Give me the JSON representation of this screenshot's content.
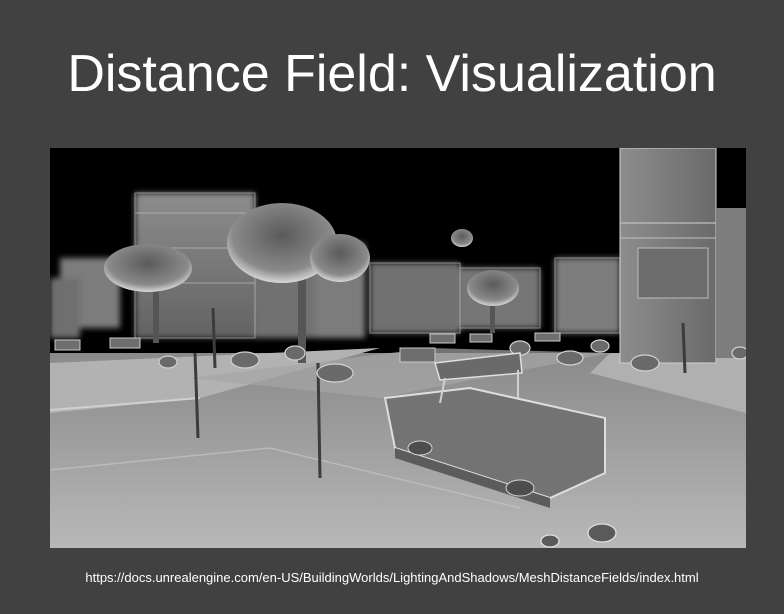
{
  "slide": {
    "title": "Distance Field: Visualization",
    "source_url": "https://docs.unrealengine.com/en-US/BuildingWorlds/LightingAndShadows/MeshDistanceFields/index.html"
  },
  "image": {
    "subject": "mesh-distance-field-visualization-of-town-street-scene"
  },
  "colors": {
    "background": "#414141",
    "text": "#ffffff",
    "sky": "#000000"
  }
}
